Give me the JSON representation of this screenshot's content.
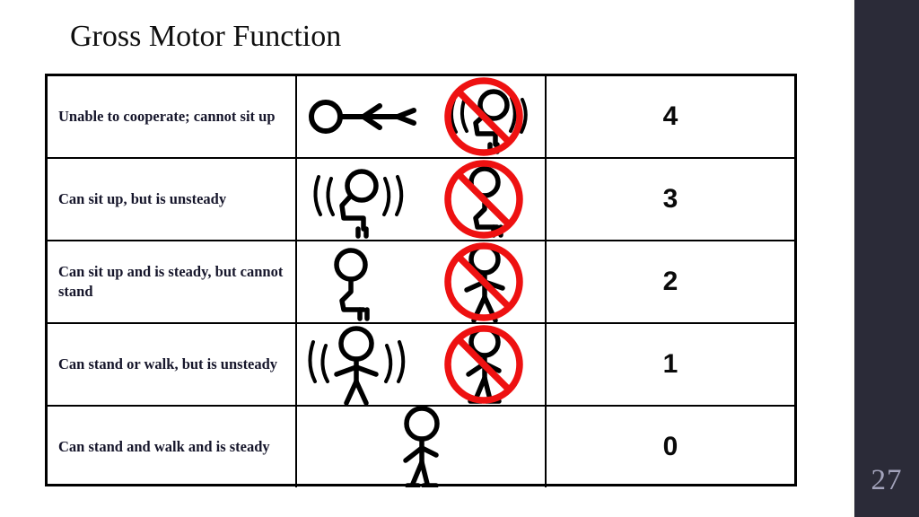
{
  "slide": {
    "title": "Gross Motor Function",
    "page_number": "27",
    "accent_color": "#2b2b38",
    "prohibition_color": "#ee1111",
    "text_color": "#16162b"
  },
  "table": {
    "rows": [
      {
        "description": "Unable to cooperate;  cannot sit up",
        "score": "4",
        "figure_left": "lying-figure",
        "figure_right": "unsteady-sitting-figure-prohibited"
      },
      {
        "description": "Can sit up, but is unsteady",
        "score": "3",
        "figure_left": "unsteady-sitting-figure",
        "figure_right": "steady-sitting-figure-prohibited"
      },
      {
        "description": "Can sit up and is steady, but cannot stand",
        "score": "2",
        "figure_left": "steady-sitting-figure",
        "figure_right": "standing-figure-prohibited"
      },
      {
        "description": "Can stand or walk, but is unsteady",
        "score": "1",
        "figure_left": "unsteady-standing-figure",
        "figure_right": "walking-figure-prohibited"
      },
      {
        "description": "Can stand and walk and is steady",
        "score": "0",
        "figure_left": "walking-figure",
        "figure_right": ""
      }
    ]
  }
}
